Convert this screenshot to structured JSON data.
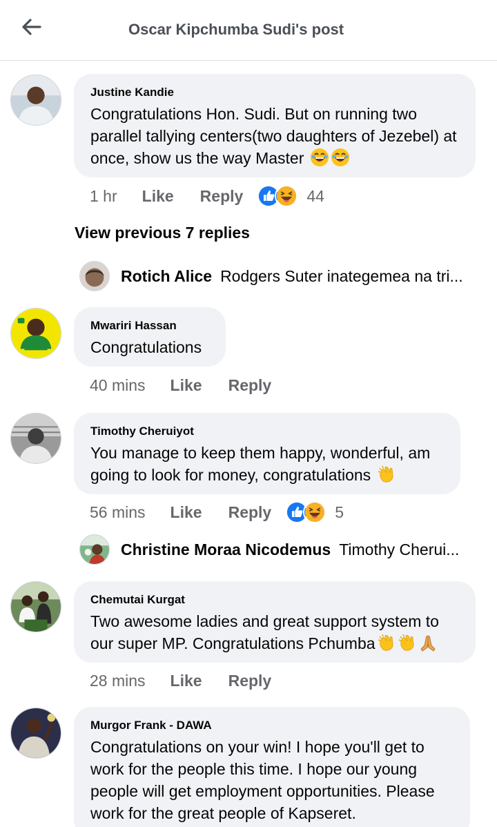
{
  "header": {
    "title": "Oscar Kipchumba Sudi's post",
    "back_icon": "back-arrow-icon"
  },
  "actions": {
    "like": "Like",
    "reply": "Reply"
  },
  "colors": {
    "like_blue": "#1877f2",
    "haha_yellow": "#f7b125",
    "bubble_bg": "#f0f2f5",
    "meta_gray": "#65676b"
  },
  "comments": [
    {
      "author": "Justine Kandie",
      "text": "Congratulations Hon. Sudi. But on running two parallel tallying centers(two daughters of Jezebel) at once, show us the way Master",
      "emojis": [
        "laughing-tears-emoji",
        "laughing-tears-emoji"
      ],
      "time": "1 hr",
      "reactions": [
        "like",
        "haha"
      ],
      "reaction_count": "44"
    },
    {
      "author": "Mwariri Hassan",
      "text": "Congratulations",
      "time": "40 mins"
    },
    {
      "author": "Timothy Cheruiyot",
      "text": "You manage to keep them happy, wonderful, am going to look for money, congratulations",
      "emojis": [
        "clapping-hands-emoji"
      ],
      "time": "56 mins",
      "reactions": [
        "like",
        "haha"
      ],
      "reaction_count": "5"
    },
    {
      "author": "Chemutai Kurgat",
      "text": "Two awesome ladies and great support system to our super MP. Congratulations Pchumba",
      "emojis": [
        "clapping-hands-emoji",
        "clapping-hands-emoji",
        "folded-hands-emoji"
      ],
      "time": "28 mins"
    },
    {
      "author": "Murgor Frank - DAWA",
      "text": "Congratulations on your win! I hope you'll get to work for the people this time. I hope our young people will get employment opportunities. Please work for the great people of Kapseret."
    }
  ],
  "view_previous": "View previous 7 replies",
  "replies": [
    {
      "name": "Rotich Alice",
      "snippet": "Rodgers Suter inategemea na tri..."
    },
    {
      "name": "Christine Moraa Nicodemus",
      "snippet": "Timothy Cherui..."
    }
  ]
}
